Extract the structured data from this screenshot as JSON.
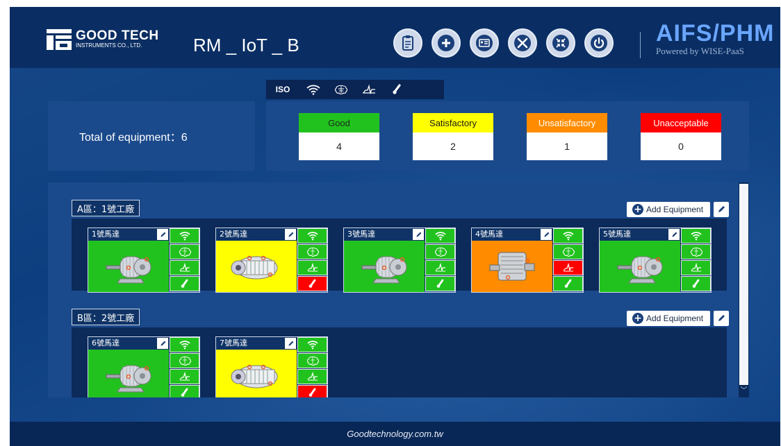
{
  "header": {
    "company_name": "GOOD TECH",
    "company_sub": "INSTRUMENTS CO., LTD.",
    "app_title": "RM _ IoT _ B",
    "buttons": [
      "clipboard-icon",
      "plus-icon",
      "id-card-icon",
      "tools-icon",
      "collapse-icon",
      "power-icon"
    ],
    "brand_title": "AIFS/PHM",
    "brand_sub": "Powered by WISE-PaaS"
  },
  "tabs": {
    "items": [
      {
        "label": "ISO",
        "icon": "iso",
        "active": true
      },
      {
        "label": "",
        "icon": "wifi-icon"
      },
      {
        "label": "",
        "icon": "brain-icon"
      },
      {
        "label": "",
        "icon": "waveform-icon"
      },
      {
        "label": "",
        "icon": "thermometer-icon"
      }
    ]
  },
  "summary": {
    "total_label": "Total of equipment：6",
    "stats": [
      {
        "label": "Good",
        "value": "4",
        "color": "#22c21e",
        "text_color": "#1a2a1a"
      },
      {
        "label": "Satisfactory",
        "value": "2",
        "color": "#ffff00",
        "text_color": "#1a1a1a"
      },
      {
        "label": "Unsatisfactory",
        "value": "1",
        "color": "#ff8c00",
        "text_color": "#ffffff"
      },
      {
        "label": "Unacceptable",
        "value": "0",
        "color": "#ff0000",
        "text_color": "#ffffff"
      }
    ]
  },
  "zones": [
    {
      "label": "A區：1號工廠",
      "add_label": "Add Equipment",
      "equipment": [
        {
          "name": "1號馬達",
          "status_color": "#22c21e",
          "sensors": [
            "#22c21e",
            "#22c21e",
            "#22c21e",
            "#22c21e"
          ],
          "image": "motor-icon"
        },
        {
          "name": "2號馬達",
          "status_color": "#ffff00",
          "sensors": [
            "#22c21e",
            "#22c21e",
            "#22c21e",
            "#ff0000"
          ],
          "image": "turbine-icon"
        },
        {
          "name": "3號馬達",
          "status_color": "#22c21e",
          "sensors": [
            "#22c21e",
            "#22c21e",
            "#22c21e",
            "#22c21e"
          ],
          "image": "motor-icon"
        },
        {
          "name": "4號馬達",
          "status_color": "#ff8c00",
          "sensors": [
            "#22c21e",
            "#22c21e",
            "#ff0000",
            "#22c21e"
          ],
          "image": "gearbox-icon"
        },
        {
          "name": "5號馬達",
          "status_color": "#22c21e",
          "sensors": [
            "#22c21e",
            "#22c21e",
            "#22c21e",
            "#22c21e"
          ],
          "image": "motor-icon"
        }
      ]
    },
    {
      "label": "B區：2號工廠",
      "add_label": "Add Equipment",
      "equipment": [
        {
          "name": "6號馬達",
          "status_color": "#22c21e",
          "sensors": [
            "#22c21e",
            "#22c21e",
            "#22c21e",
            "#22c21e"
          ],
          "image": "motor-icon"
        },
        {
          "name": "7號馬達",
          "status_color": "#ffff00",
          "sensors": [
            "#22c21e",
            "#22c21e",
            "#22c21e",
            "#ff0000"
          ],
          "image": "turbine-icon"
        }
      ]
    }
  ],
  "footer": {
    "text": "Goodtechnology.com.tw"
  }
}
